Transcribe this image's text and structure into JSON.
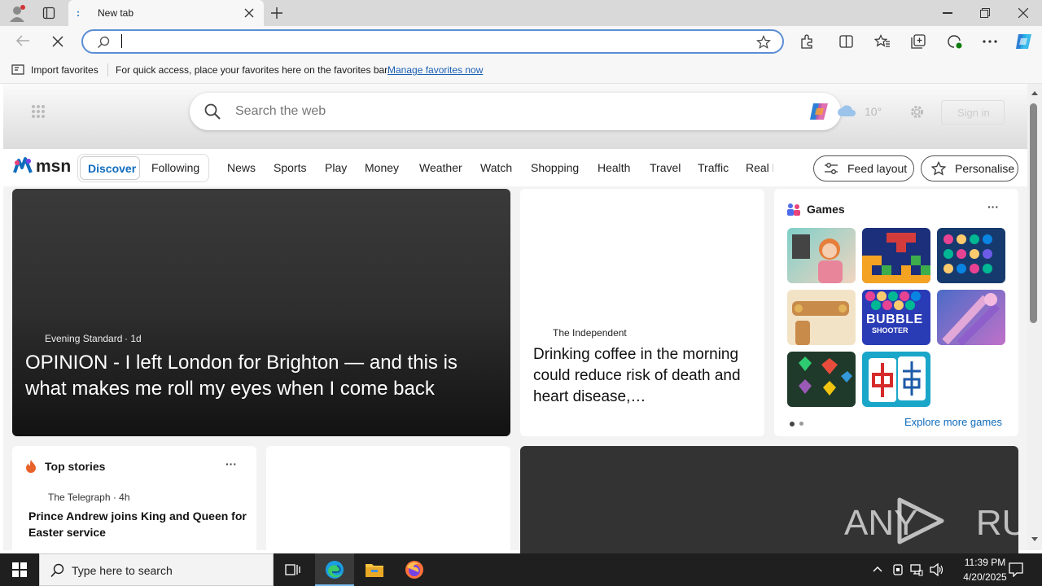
{
  "browser": {
    "tab_title": "New tab",
    "address_value": "",
    "favbar": {
      "import_label": "Import favorites",
      "hint": "For quick access, place your favorites here on the favorites bar.",
      "manage_link": "Manage favorites now"
    }
  },
  "msn": {
    "search_placeholder": "Search the web",
    "weather_temp": "10°",
    "sign_in": "Sign in",
    "logo_text": "msn",
    "toggle": [
      "Discover",
      "Following"
    ],
    "nav": [
      "News",
      "Sports",
      "Play",
      "Money",
      "Weather",
      "Watch",
      "Shopping",
      "Health",
      "Travel",
      "Traffic",
      "Real E"
    ],
    "feed_layout": "Feed layout",
    "personalise": "Personalise",
    "hero": {
      "source": "Evening Standard",
      "age": "· 1d",
      "headline": "OPINION - I left London for Brighton — and this is what makes me roll my eyes when I come back"
    },
    "card2": {
      "source": "The Independent",
      "headline": "Drinking coffee in the morning could reduce risk of death and heart disease,…"
    },
    "games": {
      "title": "Games",
      "more": "···",
      "explore": "Explore more games",
      "bubble_text": "BUBBLE",
      "shooter_text": "SHOOTER"
    },
    "top_stories": {
      "title": "Top stories",
      "more": "···",
      "source": "The Telegraph · 4h",
      "headline": "Prince Andrew joins King and Queen for Easter service"
    },
    "watermark": "ANY RUN"
  },
  "taskbar": {
    "search_placeholder": "Type here to search",
    "time": "11:39 PM",
    "date": "4/20/2025"
  },
  "colors": {
    "accent": "#0f6cbd",
    "omnibox_border": "#5b8ed6",
    "taskbar": "#1f1f1f"
  }
}
